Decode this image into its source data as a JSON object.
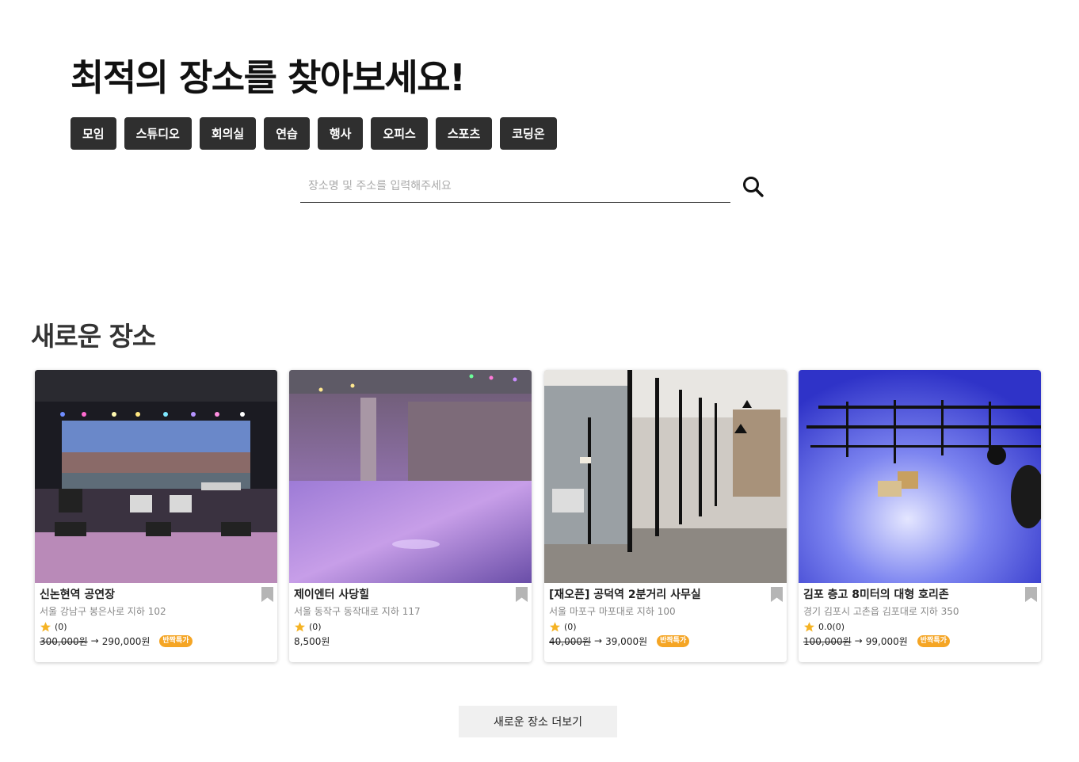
{
  "hero": {
    "title": "최적의 장소를 찾아보세요!"
  },
  "categories": [
    "모임",
    "스튜디오",
    "회의실",
    "연습",
    "행사",
    "오피스",
    "스포츠",
    "코딩온"
  ],
  "search": {
    "placeholder": "장소명 및 주소를 입력해주세요",
    "value": ""
  },
  "section": {
    "title": "새로운 장소",
    "more_label": "새로운 장소 더보기"
  },
  "colors": {
    "category_bg": "#2f2f2f",
    "badge": "#f5a524",
    "star": "#f5b324",
    "bookmark": "#b5b5b5"
  },
  "places": [
    {
      "name": "신논현역 공연장",
      "address": "서울 강남구 봉은사로 지하 102",
      "rating": "(0)",
      "old_price": "300,000원",
      "arrow": "→",
      "price": "290,000원",
      "badge": "반짝특가",
      "image": "concert stage with LED screen"
    },
    {
      "name": "제이엔터 사당힐",
      "address": "서울 동작구 동작대로 지하 117",
      "rating": "(0)",
      "old_price": "",
      "arrow": "",
      "price": "8,500원",
      "badge": "",
      "image": "purple lit dance practice room"
    },
    {
      "name": "[재오픈] 공덕역 2분거리 사무실",
      "address": "서울 마포구 마포대로 지하 100",
      "rating": "(0)",
      "old_price": "40,000원",
      "arrow": "→",
      "price": "39,000원",
      "badge": "반짝특가",
      "image": "office hallway with glass partitions"
    },
    {
      "name": "김포 층고 8미터의 대형 호리존",
      "address": "경기 김포시 고촌읍 김포대로 지하 350",
      "rating": "0.0(0)",
      "old_price": "100,000원",
      "arrow": "→",
      "price": "99,000원",
      "badge": "반짝특가",
      "image": "blue horizon photo studio"
    }
  ]
}
